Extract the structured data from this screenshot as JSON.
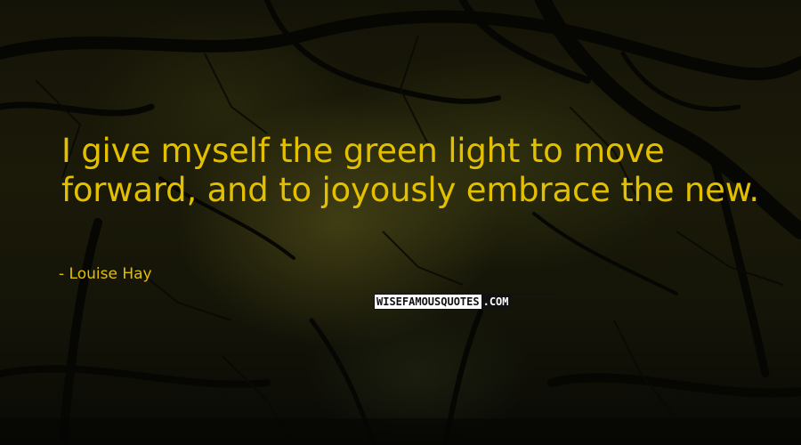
{
  "quote": {
    "text": "I give myself the green light to move forward, and to joyously embrace the new.",
    "author": "- Louise Hay"
  },
  "watermark": {
    "brand": "WISEFAMOUSQUOTES",
    "suffix": ".COM"
  },
  "colors": {
    "quote_text": "#e2c000",
    "background": "#141307"
  }
}
